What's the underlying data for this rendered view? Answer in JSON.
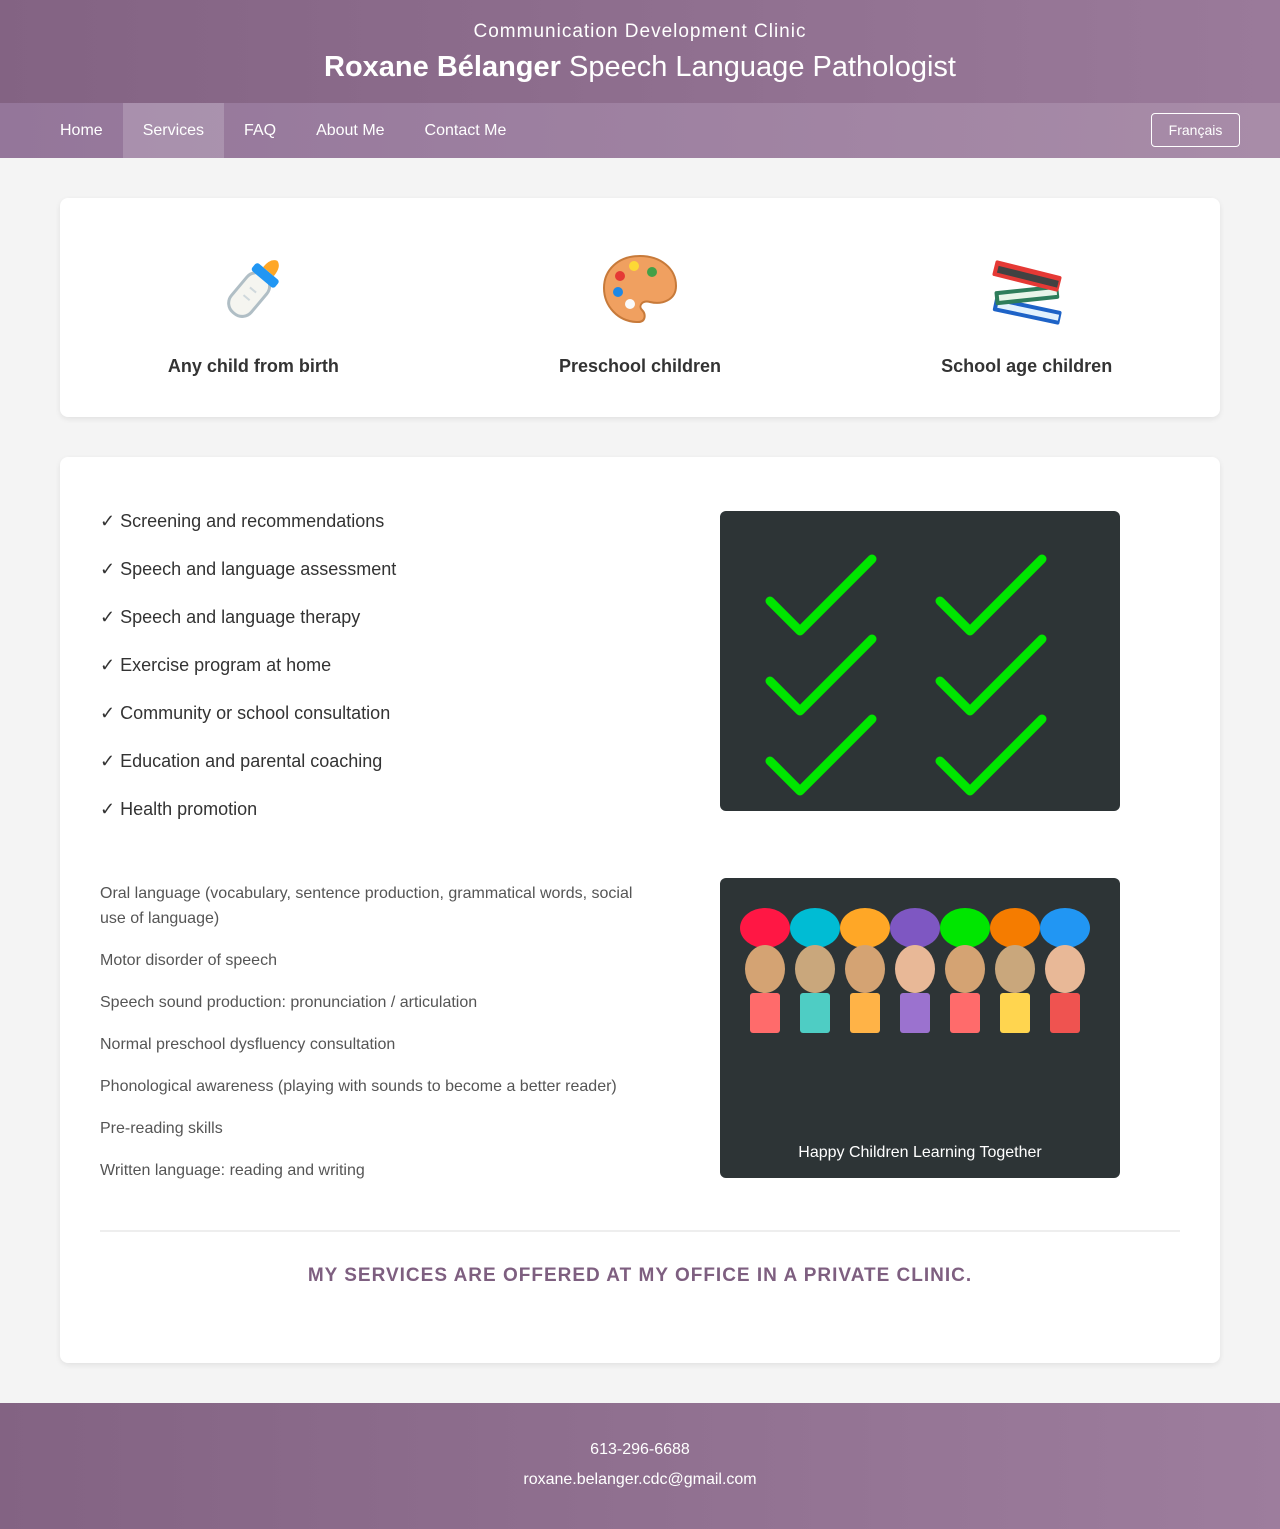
{
  "header": {
    "subtitle": "Communication Development Clinic",
    "name": "Roxane Bélanger",
    "profession": "Speech Language Pathologist"
  },
  "nav": {
    "items": [
      "Home",
      "Services",
      "FAQ",
      "About Me",
      "Contact Me"
    ],
    "active": "Services",
    "language_button": "Français"
  },
  "age_groups": [
    {
      "icon": "baby-bottle-icon",
      "label": "Any child from birth"
    },
    {
      "icon": "palette-icon",
      "label": "Preschool children"
    },
    {
      "icon": "books-icon",
      "label": "School age children"
    }
  ],
  "services": [
    "✓ Screening and recommendations",
    "✓ Speech and language assessment",
    "✓ Speech and language therapy",
    "✓ Exercise program at home",
    "✓ Community or school consultation",
    "✓ Education and parental coaching",
    "✓ Health promotion"
  ],
  "areas": [
    "Oral language (vocabulary, sentence production, grammatical words, social use of language)",
    "Motor disorder of speech",
    "Speech sound production: pronunciation / articulation",
    "Normal preschool dysfluency consultation",
    "Phonological awareness (playing with sounds to become a better reader)",
    "Pre-reading skills",
    "Written language: reading and writing"
  ],
  "illustration": {
    "caption": "Happy Children Learning Together",
    "hair_colors": [
      "#ff1744",
      "#00bcd4",
      "#ffa726",
      "#7e57c2",
      "#00e600",
      "#f57c00",
      "#2196f3"
    ],
    "face_colors": [
      "#d4a373",
      "#c9a77c",
      "#d4a373",
      "#e8b897",
      "#d4a373",
      "#c9a77c",
      "#e8b897"
    ],
    "body_colors": [
      "#ff6b6b",
      "#4ecdc4",
      "#ffb347",
      "#9b72cf",
      "#ff6b6b",
      "#ffd54f",
      "#ef5350"
    ]
  },
  "offer": "My services are offered at my office in a private clinic.",
  "footer": {
    "phone": "613-296-6688",
    "email": "roxane.belanger.cdc@gmail.com"
  },
  "colors": {
    "brand": "#836383",
    "check": "#00e600",
    "panel": "#2d3436"
  }
}
